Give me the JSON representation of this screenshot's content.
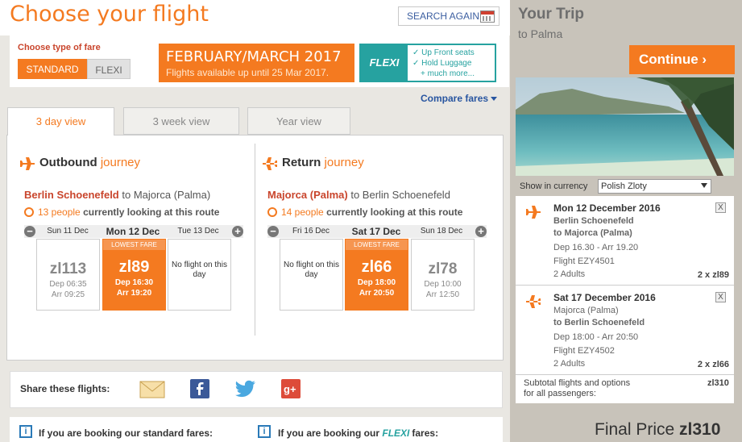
{
  "header": {
    "title": "Choose your flight",
    "search_again": "SEARCH AGAIN"
  },
  "fare": {
    "label": "Choose type of fare",
    "options": [
      "STANDARD",
      "FLEXI"
    ],
    "selected": "STANDARD"
  },
  "promo": {
    "title": "FEBRUARY/MARCH 2017",
    "subtitle": "Flights available up until 25 Mar 2017."
  },
  "flexi_banner": {
    "logo": "FLEXI",
    "features": [
      "✓ Up Front seats",
      "✓ Hold Luggage",
      "+ much more..."
    ]
  },
  "compare_fares": "Compare fares",
  "tabs": [
    "3 day view",
    "3 week view",
    "Year view"
  ],
  "outbound": {
    "title": "Outbound",
    "title_suffix": "journey",
    "from": "Berlin Schoenefeld",
    "to_word": "to",
    "to": "Majorca (Palma)",
    "looking_count": "13 people",
    "looking_text": "currently looking at this route",
    "days": [
      {
        "label": "Sun 11 Dec",
        "price": "zl113",
        "dep": "Dep 06:35",
        "arr": "Arr 09:25"
      },
      {
        "label": "Mon 12 Dec",
        "badge": "LOWEST FARE",
        "price": "zl89",
        "dep": "Dep 16:30",
        "arr": "Arr 19:20"
      },
      {
        "label": "Tue 13 Dec",
        "note": "No flight on this day"
      }
    ]
  },
  "return": {
    "title": "Return",
    "title_suffix": "journey",
    "from": "Majorca (Palma)",
    "to_word": "to",
    "to": "Berlin Schoenefeld",
    "looking_count": "14 people",
    "looking_text": "currently looking at this route",
    "days": [
      {
        "label": "Fri 16 Dec",
        "note": "No flight on this day"
      },
      {
        "label": "Sat 17 Dec",
        "badge": "LOWEST FARE",
        "price": "zl66",
        "dep": "Dep 18:00",
        "arr": "Arr 20:50"
      },
      {
        "label": "Sun 18 Dec",
        "price": "zl78",
        "dep": "Dep 10:00",
        "arr": "Arr 12:50"
      }
    ]
  },
  "share": {
    "label": "Share these flights:"
  },
  "info": {
    "standard_text": "If you are booking our standard fares:",
    "flexi_prefix": "If you are booking our",
    "flexi_word": "FLEXI",
    "flexi_suffix": "fares:"
  },
  "trip": {
    "title": "Your Trip",
    "subtitle": "to Palma",
    "continue": "Continue ›",
    "currency_label": "Show in currency",
    "currency": "Polish Zloty",
    "segments": [
      {
        "date": "Mon 12 December 2016",
        "from": "Berlin Schoenefeld",
        "to": "to Majorca (Palma)",
        "times": "Dep 16.30 - Arr 19.20",
        "flight": "Flight EZY4501",
        "pax": "2 Adults",
        "amount": "2 x zl89"
      },
      {
        "date": "Sat 17 December 2016",
        "from": "Majorca (Palma)",
        "to": "to Berlin Schoenefeld",
        "times": "Dep 18:00 - Arr 20:50",
        "flight": "Flight EZY4502",
        "pax": "2 Adults",
        "amount": "2 x zl66"
      }
    ],
    "subtotal_label_1": "Subtotal flights and options",
    "subtotal_label_2": "for all passengers:",
    "subtotal": "zl310",
    "final_label": "Final Price",
    "final_price": "zl310"
  },
  "colors": {
    "accent": "#f47a20",
    "flexi": "#26a2a0",
    "link": "#2855a0",
    "panel_bg": "#e9e7e2",
    "trip_bg": "#c8c3ba"
  }
}
